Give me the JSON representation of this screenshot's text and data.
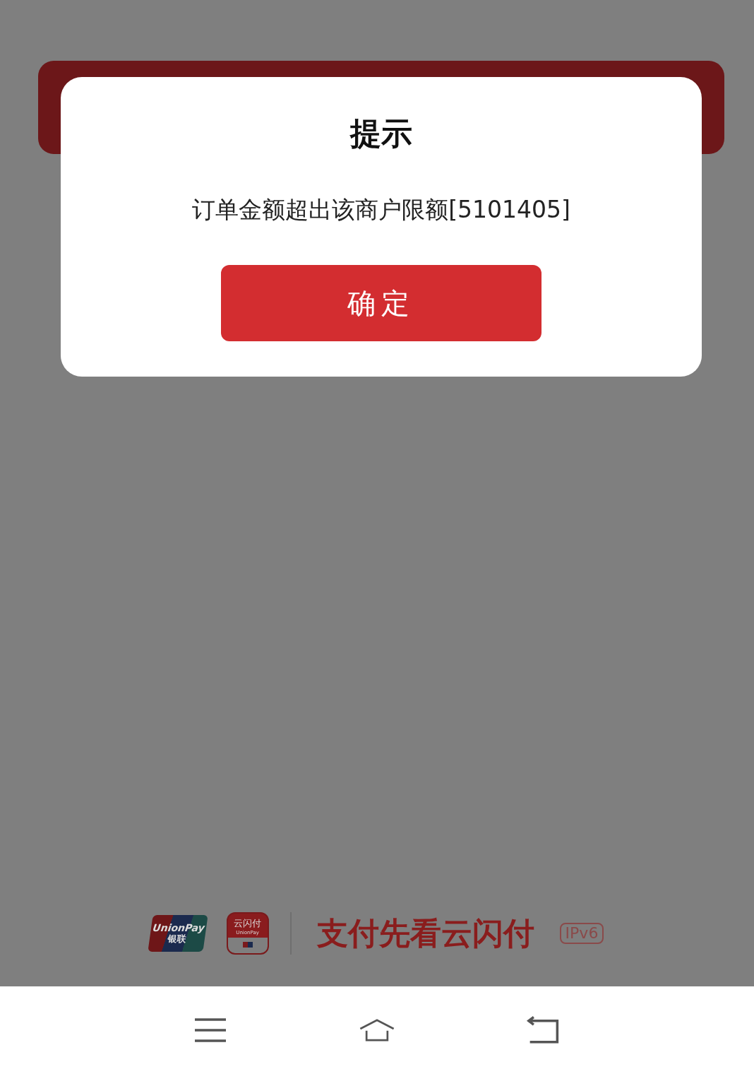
{
  "dialog": {
    "title": "提示",
    "message": "订单金额超出该商户限额[5101405]",
    "button": "确定"
  },
  "footer": {
    "unionpay_logo": {
      "latin": "UnionPay",
      "chinese": "银联"
    },
    "app_logo": {
      "chinese": "云闪付",
      "latin": "UnionPay"
    },
    "slogan": "支付先看云闪付",
    "badge": "IPv6"
  },
  "nav_bar": {
    "buttons": [
      {
        "kind": "menu"
      },
      {
        "kind": "home"
      },
      {
        "kind": "back"
      }
    ]
  }
}
